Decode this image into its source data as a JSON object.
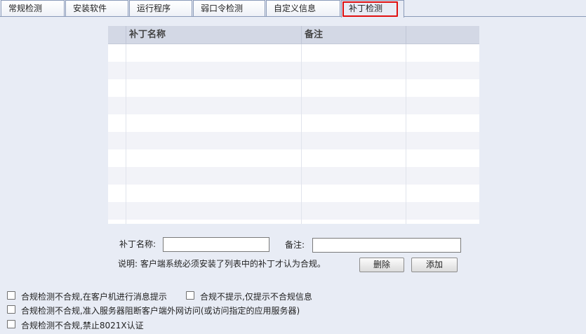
{
  "tabs": [
    {
      "label": "常规检测"
    },
    {
      "label": "安装软件"
    },
    {
      "label": "运行程序"
    },
    {
      "label": "弱口令检测"
    },
    {
      "label": "自定义信息"
    },
    {
      "label": "补丁检测"
    }
  ],
  "patch_table": {
    "columns": [
      "补丁名称",
      "备注"
    ],
    "rows": []
  },
  "form": {
    "name_label": "补丁名称:",
    "name_value": "",
    "remark_label": "备注:",
    "remark_value": "",
    "note": "说明: 客户端系统必须安装了列表中的补丁才认为合规。",
    "delete_label": "删除",
    "add_label": "添加"
  },
  "options": [
    {
      "label": "合规检测不合规,在客户机进行消息提示",
      "checked": false
    },
    {
      "label": "合规不提示,仅提示不合规信息",
      "checked": false
    },
    {
      "label": "合规检测不合规,准入服务器阻断客户端外网访问(或访问指定的应用服务器)",
      "checked": false
    },
    {
      "label": "合规检测不合规,禁止8021X认证",
      "checked": false
    }
  ]
}
